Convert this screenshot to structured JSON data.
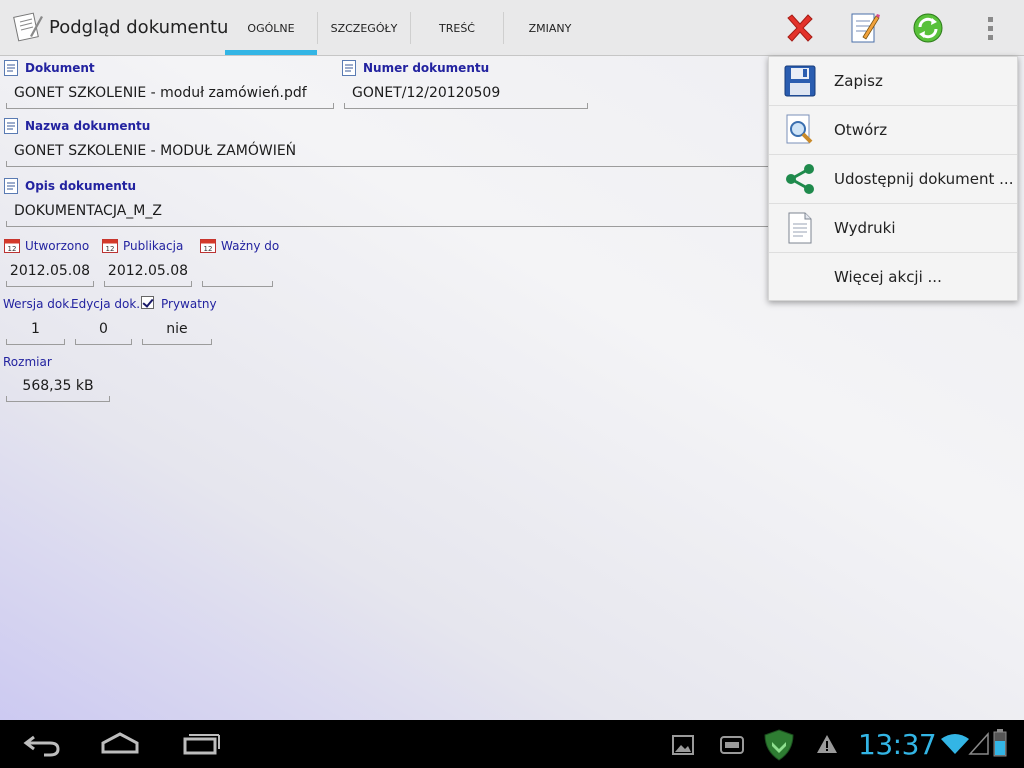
{
  "app": {
    "title": "Podgląd dokumentu"
  },
  "tabs": [
    {
      "label": "OGÓLNE"
    },
    {
      "label": "SZCZEGÓŁY"
    },
    {
      "label": "TREŚĆ"
    },
    {
      "label": "ZMIANY"
    }
  ],
  "actions": {
    "delete_icon": "red-x-icon",
    "edit_icon": "edit-document-icon",
    "sync_icon": "green-sync-icon",
    "overflow_icon": "overflow-menu-icon"
  },
  "colors": {
    "tab_indicator": "#33b5e5",
    "label_color": "#2323a0",
    "clock_color": "#33b5e5"
  },
  "form": {
    "dokument": {
      "label": "Dokument",
      "value": "GONET SZKOLENIE - moduł zamówień.pdf"
    },
    "numer": {
      "label": "Numer dokumentu",
      "value": "GONET/12/20120509"
    },
    "nazwa": {
      "label": "Nazwa dokumentu",
      "value": "GONET SZKOLENIE - MODUŁ ZAMÓWIEŃ"
    },
    "opis": {
      "label": "Opis dokumentu",
      "value": "DOKUMENTACJA_M_Z"
    },
    "utworzono": {
      "label": "Utworzono",
      "value": "2012.05.08"
    },
    "publikacja": {
      "label": "Publikacja",
      "value": "2012.05.08"
    },
    "wazny": {
      "label": "Ważny do",
      "value": ""
    },
    "wersja": {
      "label": "Wersja dok.",
      "value": "1"
    },
    "edycja": {
      "label": "Edycja dok.",
      "value": "0"
    },
    "prywatny": {
      "label": "Prywatny",
      "value": "nie",
      "checked": true
    },
    "rozmiar": {
      "label": "Rozmiar",
      "value": "568,35 kB"
    }
  },
  "menu": {
    "items": [
      {
        "label": "Zapisz",
        "icon": "save-disk-icon"
      },
      {
        "label": "Otwórz",
        "icon": "open-magnifier-icon"
      },
      {
        "label": "Udostępnij dokument ...",
        "icon": "share-icon"
      },
      {
        "label": "Wydruki",
        "icon": "print-document-icon"
      },
      {
        "label": "Więcej akcji ...",
        "icon": ""
      }
    ]
  },
  "navbar": {
    "back_icon": "back-icon",
    "home_icon": "home-icon",
    "recents_icon": "recent-apps-icon"
  },
  "status": {
    "time": "13:37",
    "icons": [
      "gallery-icon",
      "sd-card-icon",
      "security-shield-icon",
      "warning-icon",
      "wifi-icon",
      "signal-icon",
      "battery-icon"
    ]
  }
}
